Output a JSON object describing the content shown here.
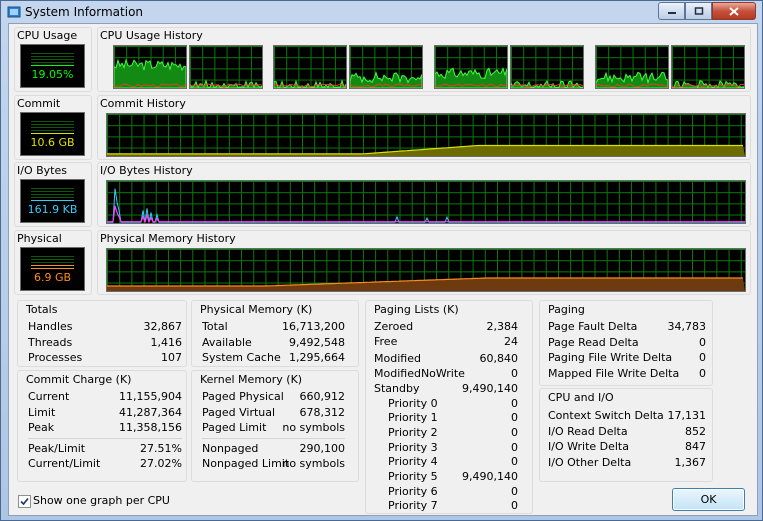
{
  "window": {
    "title": "System Information"
  },
  "colors": {
    "cpu": "#00ff00",
    "commit": "#e0e000",
    "io": "#33ccff",
    "physical": "#ff8c1a",
    "grid": "#0b7a0b"
  },
  "cpu_usage": {
    "label": "CPU Usage",
    "value": "19.05%",
    "history_label": "CPU Usage History",
    "per_cpu_level": [
      0.55,
      0.05,
      0.05,
      0.25,
      0.35,
      0.05,
      0.25,
      0.05
    ]
  },
  "commit": {
    "label": "Commit",
    "value": "10.6 GB",
    "history_label": "Commit History"
  },
  "io_bytes": {
    "label": "I/O Bytes",
    "value": "161.9  KB",
    "history_label": "I/O Bytes History"
  },
  "physical": {
    "label": "Physical",
    "value": "6.9 GB",
    "history_label": "Physical Memory History"
  },
  "totals": {
    "title": "Totals",
    "rows": [
      {
        "k": "Handles",
        "v": "32,867"
      },
      {
        "k": "Threads",
        "v": "1,416"
      },
      {
        "k": "Processes",
        "v": "107"
      }
    ]
  },
  "commit_charge": {
    "title": "Commit Charge (K)",
    "rows": [
      {
        "k": "Current",
        "v": "11,155,904"
      },
      {
        "k": "Limit",
        "v": "41,287,364"
      },
      {
        "k": "Peak",
        "v": "11,358,156"
      },
      {
        "k": "Peak/Limit",
        "v": "27.51%"
      },
      {
        "k": "Current/Limit",
        "v": "27.02%"
      }
    ]
  },
  "physical_memory": {
    "title": "Physical Memory (K)",
    "rows": [
      {
        "k": "Total",
        "v": "16,713,200"
      },
      {
        "k": "Available",
        "v": "9,492,548"
      },
      {
        "k": "System Cache",
        "v": "1,295,664"
      }
    ]
  },
  "kernel_memory": {
    "title": "Kernel Memory (K)",
    "rows": [
      {
        "k": "Paged Physical",
        "v": "660,912"
      },
      {
        "k": "Paged Virtual",
        "v": "678,312"
      },
      {
        "k": "Paged Limit",
        "v": "no symbols"
      },
      {
        "k": "Nonpaged",
        "v": "290,100"
      },
      {
        "k": "Nonpaged Limit",
        "v": "no symbols"
      }
    ]
  },
  "paging_lists": {
    "title": "Paging Lists (K)",
    "rows": [
      {
        "k": "Zeroed",
        "v": "2,384"
      },
      {
        "k": "Free",
        "v": "24"
      },
      {
        "k": "Modified",
        "v": "60,840"
      },
      {
        "k": "ModifiedNoWrite",
        "v": "0"
      },
      {
        "k": "Standby",
        "v": "9,490,140"
      },
      {
        "k": "Priority 0",
        "v": "0"
      },
      {
        "k": "Priority 1",
        "v": "0"
      },
      {
        "k": "Priority 2",
        "v": "0"
      },
      {
        "k": "Priority 3",
        "v": "0"
      },
      {
        "k": "Priority 4",
        "v": "0"
      },
      {
        "k": "Priority 5",
        "v": "9,490,140"
      },
      {
        "k": "Priority 6",
        "v": "0"
      },
      {
        "k": "Priority 7",
        "v": "0"
      }
    ]
  },
  "paging": {
    "title": "Paging",
    "rows": [
      {
        "k": "Page Fault Delta",
        "v": "34,783"
      },
      {
        "k": "Page Read Delta",
        "v": "0"
      },
      {
        "k": "Paging File Write Delta",
        "v": "0"
      },
      {
        "k": "Mapped File Write Delta",
        "v": "0"
      }
    ]
  },
  "cpu_io": {
    "title": "CPU and I/O",
    "rows": [
      {
        "k": "Context Switch Delta",
        "v": "17,131"
      },
      {
        "k": "I/O Read Delta",
        "v": "852"
      },
      {
        "k": "I/O Write Delta",
        "v": "847"
      },
      {
        "k": "I/O Other Delta",
        "v": "1,367"
      }
    ]
  },
  "footer": {
    "checkbox_label": "Show one graph per CPU",
    "checkbox_checked": true,
    "ok_label": "OK"
  }
}
